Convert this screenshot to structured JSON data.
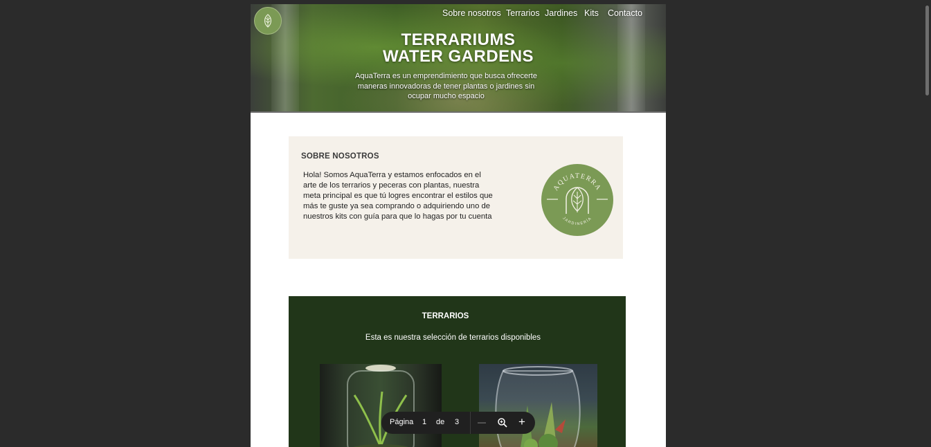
{
  "nav": {
    "items": [
      "Sobre nosotros",
      "Terrarios",
      "Jardines",
      "Kits",
      "Contacto"
    ]
  },
  "hero": {
    "title_line1": "TERRARIUMS",
    "title_line2": "WATER GARDENS",
    "description": "AquaTerra es un emprendimiento que busca ofrecerte maneras innovadoras de tener plantas o jardines sin ocupar mucho espacio"
  },
  "about": {
    "title": "SOBRE NOSOTROS",
    "text": "Hola! Somos AquaTerra y estamos enfocados en el arte de los terrarios y peceras  con plantas, nuestra meta principal es que tú logres encontrar el estilos que más te guste ya sea comprando o adquiriendo uno de nuestros kits con guía para que lo hagas por tu cuenta",
    "logo_top": "AQUATERRA",
    "logo_bottom": "JARDINERÍA"
  },
  "terrarios": {
    "title": "TERRARIOS",
    "subtitle": "Esta es nuestra selección de terrarios disponibles"
  },
  "pdf_toolbar": {
    "page_label": "Página",
    "current_page": "1",
    "of_label": "de",
    "total_pages": "3",
    "zoom_out": "—",
    "zoom_in": "+"
  },
  "colors": {
    "brand_green": "#7b9a55",
    "dark_green": "#213619",
    "cream": "#f5f1ea"
  }
}
